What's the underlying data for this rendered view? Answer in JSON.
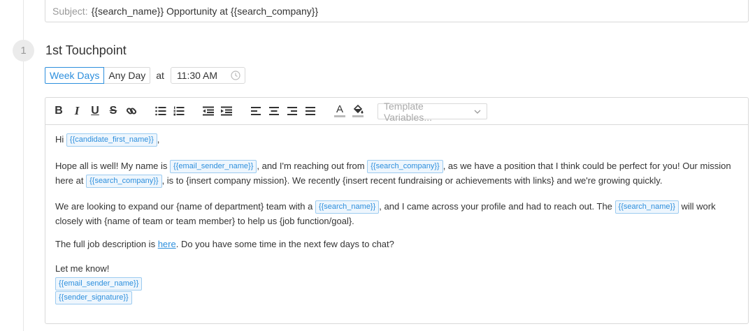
{
  "subject": {
    "label": "Subject:",
    "value": "{{search_name}} Opportunity at {{search_company}}"
  },
  "step": {
    "number": "1",
    "title": "1st Touchpoint"
  },
  "schedule": {
    "week_days": "Week Days",
    "any_day": "Any Day",
    "at": "at",
    "time": "11:30 AM",
    "selected": "Week Days"
  },
  "toolbar": {
    "bold": "B",
    "italic": "I",
    "underline": "U",
    "strike": "S",
    "text_color": "A",
    "template_placeholder": "Template Variables...",
    "icons": [
      "bold-icon",
      "italic-icon",
      "underline-icon",
      "strikethrough-icon",
      "link-icon",
      "bullet-list-icon",
      "numbered-list-icon",
      "outdent-icon",
      "indent-icon",
      "align-left-icon",
      "align-center-icon",
      "align-right-icon",
      "justify-icon",
      "text-color-icon",
      "highlight-icon"
    ]
  },
  "colors": {
    "accent": "#2d8fdd",
    "border": "#d9d9d9",
    "muted": "#999999"
  },
  "email": {
    "p1": {
      "t1": "Hi ",
      "v1": "{{candidate_first_name}}",
      "t2": ","
    },
    "p2": {
      "t1": "Hope all is well! My name is ",
      "v1": "{{email_sender_name}}",
      "t2": ", and I'm reaching out from ",
      "v2": "{{search_company}}",
      "t3": ", as we have a position that I think could be perfect for you! Our mission here at ",
      "v3": "{{search_company}}",
      "t4": ", is to {insert company mission}. We recently {insert recent fundraising or achievements with links} and we're growing quickly."
    },
    "p3": {
      "t1": "We are looking to expand our {name of department} team with a ",
      "v1": "{{search_name}}",
      "t2": ", and I came across your profile and had to reach out. The ",
      "v2": "{{search_name}}",
      "t3": " will work closely with {name of team or team member} to help us {job function/goal}."
    },
    "p4": {
      "t1": "The full job description is ",
      "link": "here",
      "t2": ". Do you have some time in the next few days to chat?"
    },
    "p5": {
      "t1": "Let me know!",
      "v1": "{{email_sender_name}}",
      "v2": "{{sender_signature}}"
    }
  }
}
